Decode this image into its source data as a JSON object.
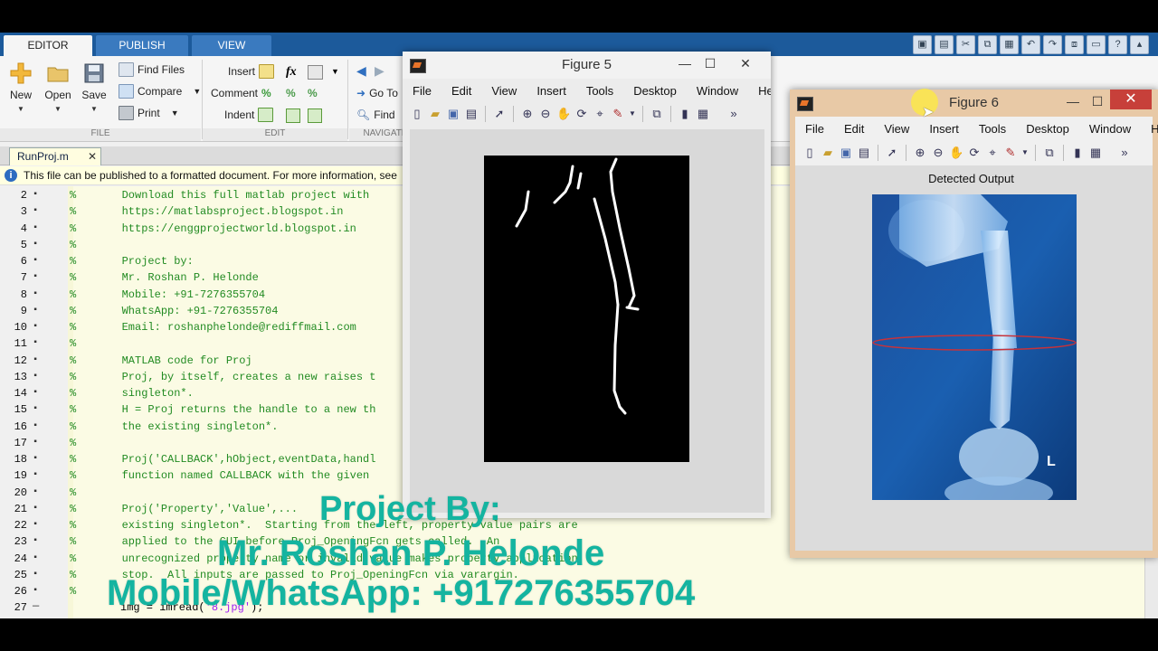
{
  "ribbon": {
    "tabs": [
      "EDITOR",
      "PUBLISH",
      "VIEW"
    ],
    "file": {
      "new": "New",
      "open": "Open",
      "save": "Save",
      "find_files": "Find Files",
      "compare": "Compare",
      "print": "Print",
      "section": "FILE"
    },
    "edit": {
      "insert": "Insert",
      "comment": "Comment",
      "indent": "Indent",
      "section": "EDIT"
    },
    "navigate": {
      "go_to": "Go To",
      "find": "Find",
      "section": "NAVIGATE"
    }
  },
  "editor": {
    "tab_name": "RunProj.m",
    "info_text": "This file can be published to a formatted document. For more information, see",
    "lines": [
      {
        "n": "2",
        "text": "%       Download this full matlab project with"
      },
      {
        "n": "3",
        "text": "%       https://matlabsproject.blogspot.in"
      },
      {
        "n": "4",
        "text": "%       https://enggprojectworld.blogspot.in"
      },
      {
        "n": "5",
        "text": "%"
      },
      {
        "n": "6",
        "text": "%       Project by:"
      },
      {
        "n": "7",
        "text": "%       Mr. Roshan P. Helonde"
      },
      {
        "n": "8",
        "text": "%       Mobile: +91-7276355704"
      },
      {
        "n": "9",
        "text": "%       WhatsApp: +91-7276355704"
      },
      {
        "n": "10",
        "text": "%       Email: roshanphelonde@rediffmail.com"
      },
      {
        "n": "11",
        "text": "%"
      },
      {
        "n": "12",
        "text": "%       MATLAB code for Proj"
      },
      {
        "n": "13",
        "text": "%       Proj, by itself, creates a new raises t"
      },
      {
        "n": "14",
        "text": "%       singleton*."
      },
      {
        "n": "15",
        "text": "%       H = Proj returns the handle to a new th"
      },
      {
        "n": "16",
        "text": "%       the existing singleton*."
      },
      {
        "n": "17",
        "text": "%"
      },
      {
        "n": "18",
        "text": "%       Proj('CALLBACK',hObject,eventData,handl"
      },
      {
        "n": "19",
        "text": "%       function named CALLBACK with the given"
      },
      {
        "n": "20",
        "text": "%"
      },
      {
        "n": "21",
        "text": "%       Proj('Property','Value',..."
      },
      {
        "n": "22",
        "text": "%       existing singleton*.  Starting from the left, property value pairs are"
      },
      {
        "n": "23",
        "text": "%       applied to the GUI before Proj_OpeningFcn gets called.  An"
      },
      {
        "n": "24",
        "text": "%       unrecognized property name or invalid value makes property application"
      },
      {
        "n": "25",
        "text": "%       stop.  All inputs are passed to Proj_OpeningFcn via varargin."
      },
      {
        "n": "26",
        "text": "%"
      }
    ],
    "last_line_no": "27",
    "last_line_code": "img = imread(",
    "last_line_str": "'8.jpg'",
    "last_line_end": ");"
  },
  "figure5": {
    "title": "Figure 5",
    "menu": [
      "File",
      "Edit",
      "View",
      "Insert",
      "Tools",
      "Desktop",
      "Window",
      "Help"
    ]
  },
  "figure6": {
    "title": "Figure 6",
    "menu": [
      "File",
      "Edit",
      "View",
      "Insert",
      "Tools",
      "Desktop",
      "Window",
      "Help"
    ],
    "axes_title": "Detected Output",
    "xray_marker": "L"
  },
  "overlay": {
    "line1": "Project By:",
    "line2": "Mr. Roshan P. Helonde",
    "line3": "Mobile/WhatsApp: +917276355704"
  },
  "colors": {
    "ribbon_blue": "#1c5a9b",
    "figure6_frame": "#e8c9a6",
    "overlay_teal": "#14b4a0",
    "comment_green": "#228b22"
  }
}
